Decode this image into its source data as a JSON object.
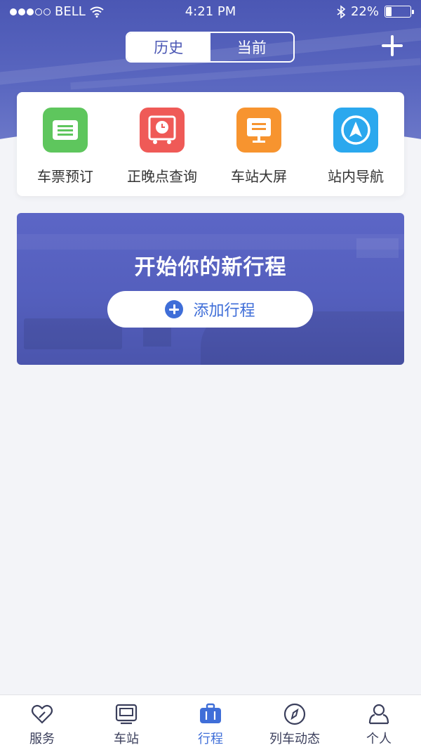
{
  "status_bar": {
    "carrier": "BELL",
    "time": "4:21 PM",
    "battery": "22%",
    "battery_level": 0.22
  },
  "header": {
    "segments": [
      {
        "label": "历史",
        "active": true
      },
      {
        "label": "当前",
        "active": false
      }
    ],
    "add_icon": "plus-icon"
  },
  "quick_actions": [
    {
      "label": "车票预订",
      "icon": "ticket-icon",
      "color": "#5ec65d"
    },
    {
      "label": "正晚点查询",
      "icon": "clock-icon",
      "color": "#ef5a57"
    },
    {
      "label": "车站大屏",
      "icon": "screen-icon",
      "color": "#f7942f"
    },
    {
      "label": "站内导航",
      "icon": "navigation-icon",
      "color": "#2ba8ee"
    }
  ],
  "banner": {
    "title": "开始你的新行程",
    "button_label": "添加行程"
  },
  "tabs": [
    {
      "label": "服务",
      "icon": "heart-icon",
      "active": false
    },
    {
      "label": "车站",
      "icon": "station-icon",
      "active": false
    },
    {
      "label": "行程",
      "icon": "briefcase-icon",
      "active": true
    },
    {
      "label": "列车动态",
      "icon": "compass-icon",
      "active": false
    },
    {
      "label": "个人",
      "icon": "person-icon",
      "active": false
    }
  ],
  "colors": {
    "primary": "#4b57b4",
    "accent": "#3f6ed8"
  }
}
